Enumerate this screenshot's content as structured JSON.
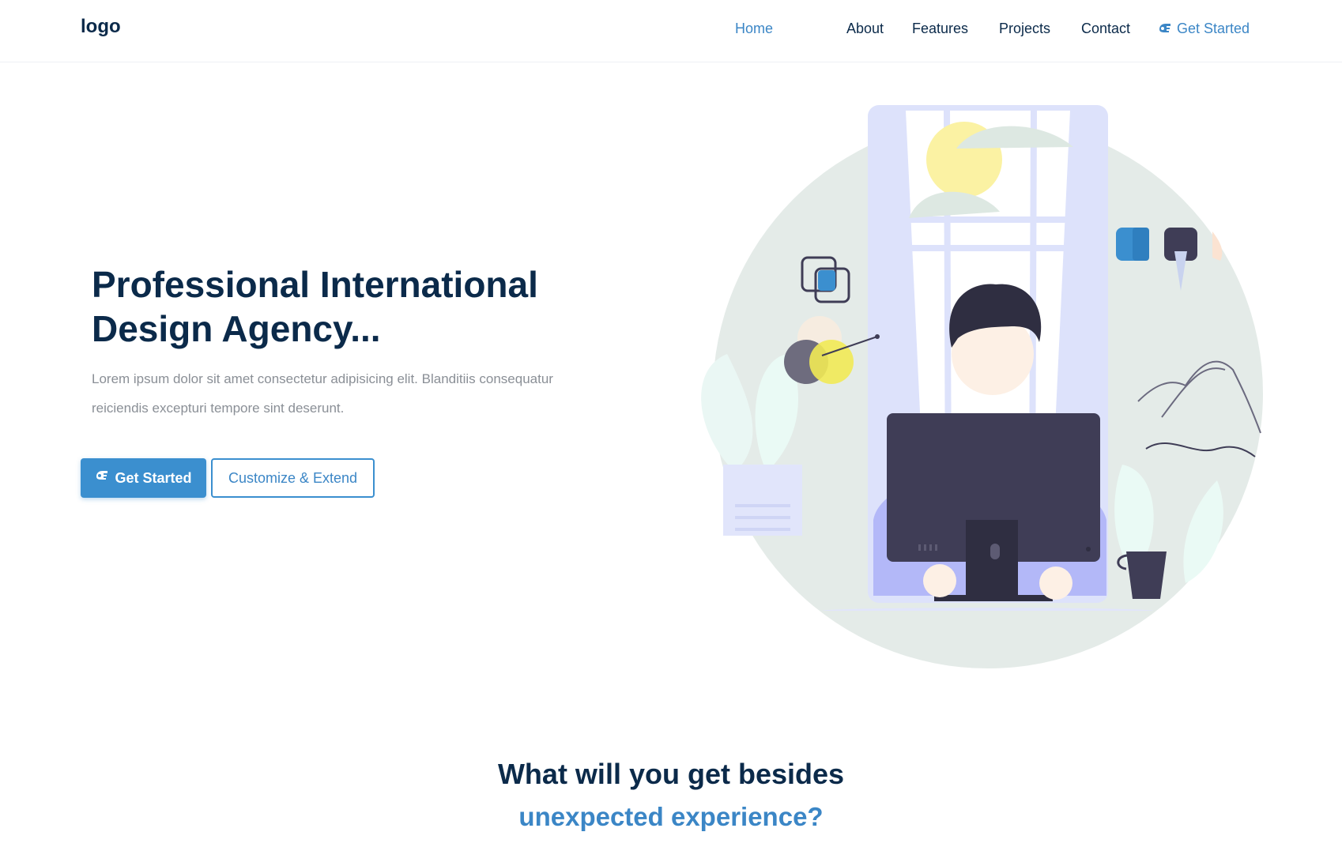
{
  "header": {
    "logo": "logo",
    "nav": [
      {
        "label": "Home",
        "active": true
      },
      {
        "label": "About",
        "active": false
      },
      {
        "label": "Features",
        "active": false
      },
      {
        "label": "Projects",
        "active": false
      },
      {
        "label": "Contact",
        "active": false
      }
    ],
    "cta_label": "Get Started",
    "cta_icon": "rocket-icon"
  },
  "hero": {
    "title_line1": "Professional International",
    "title_line2": "Design Agency...",
    "description": "Lorem ipsum dolor sit amet consectetur adipisicing elit. Blanditiis consequatur reiciendis excepturi tempore sint deserunt.",
    "primary_button": "Get Started",
    "secondary_button": "Customize & Extend",
    "illustration": "person-at-computer-illustration"
  },
  "section": {
    "title_line1": "What will you get besides",
    "title_line2": "unexpected experience?"
  },
  "colors": {
    "primary": "#3b8fcf",
    "heading": "#0b2a4a",
    "muted_text": "#8a8f96",
    "illustration_bg": "#e4ebe8",
    "monitor": "#3f3d56",
    "accent_purple": "#b3b8f8"
  }
}
